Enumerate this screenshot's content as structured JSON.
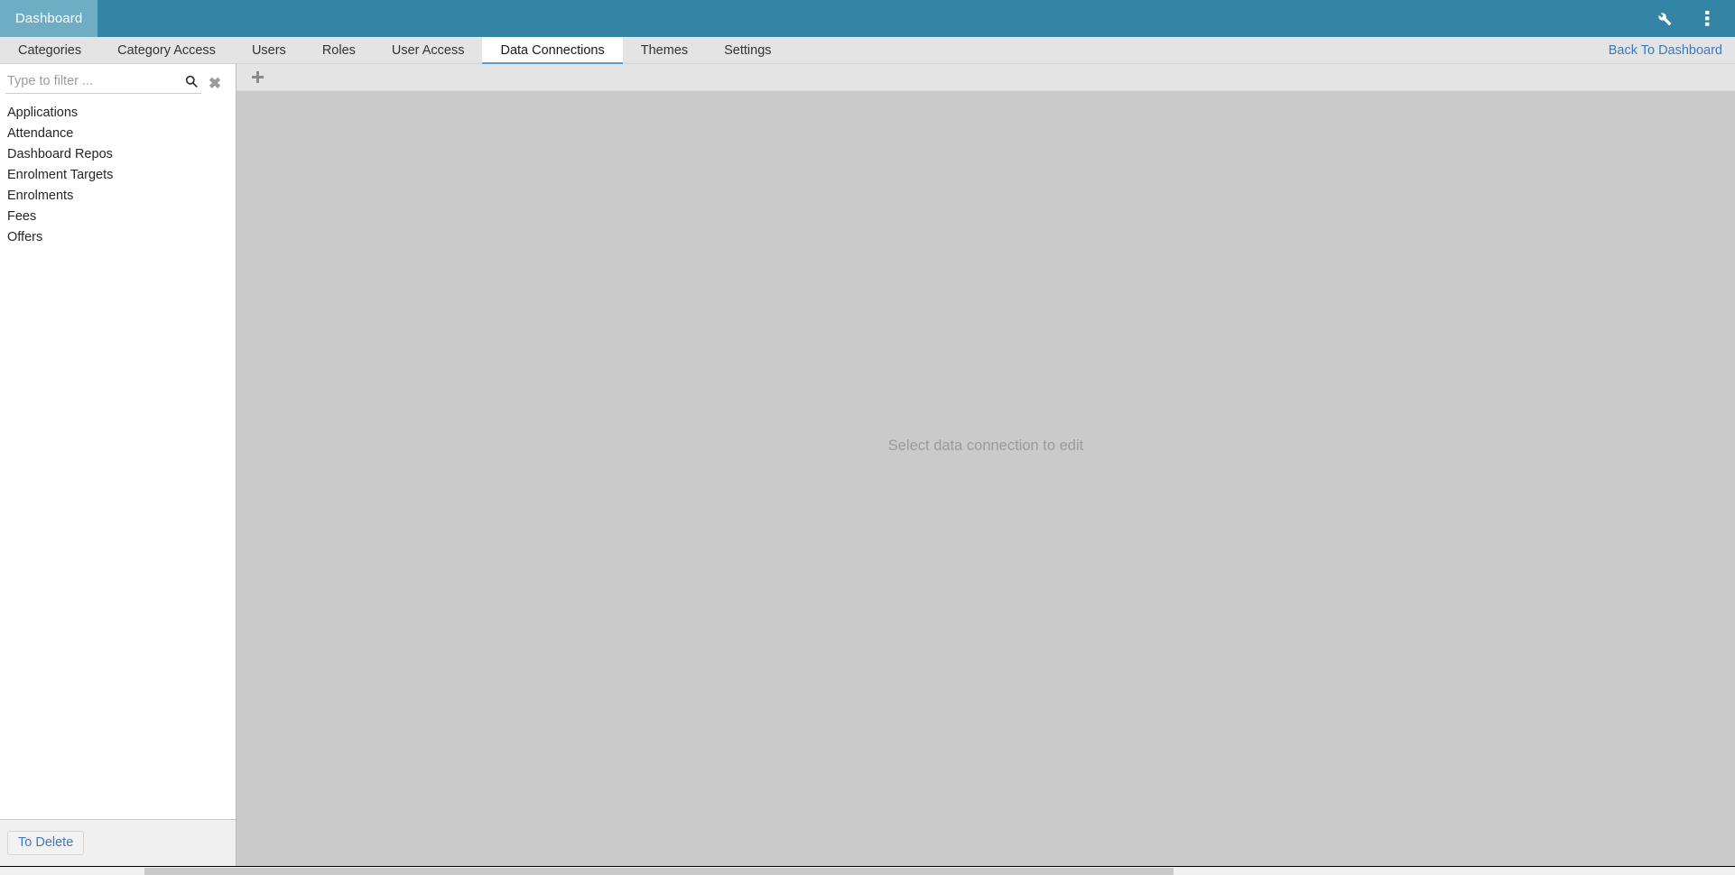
{
  "header": {
    "app_tab_label": "Dashboard",
    "icons": [
      {
        "name": "wrench-icon",
        "label": "Tools"
      },
      {
        "name": "more-vertical-icon",
        "label": "More options"
      }
    ],
    "bar_color": "#3484a5",
    "app_tab_color": "#6fadc4"
  },
  "tabs": {
    "items": [
      {
        "label": "Categories",
        "active": false
      },
      {
        "label": "Category Access",
        "active": false
      },
      {
        "label": "Users",
        "active": false
      },
      {
        "label": "Roles",
        "active": false
      },
      {
        "label": "User Access",
        "active": false
      },
      {
        "label": "Data Connections",
        "active": true
      },
      {
        "label": "Themes",
        "active": false
      },
      {
        "label": "Settings",
        "active": false
      }
    ],
    "active_index": 5,
    "active_underline_color": "#5b9bd5",
    "back_link": "Back To Dashboard",
    "link_color": "#3a7bbf"
  },
  "sidebar": {
    "filter": {
      "placeholder": "Type to filter ...",
      "value": "",
      "search_icon": "search-icon",
      "clear_icon": "clear-x-icon",
      "clear_glyph": "✖"
    },
    "connections": [
      {
        "label": "Applications"
      },
      {
        "label": "Attendance"
      },
      {
        "label": "Dashboard Repos"
      },
      {
        "label": "Enrolment Targets"
      },
      {
        "label": "Enrolments"
      },
      {
        "label": "Fees"
      },
      {
        "label": "Offers"
      }
    ],
    "footer": {
      "to_delete_label": "To Delete"
    }
  },
  "main": {
    "toolbar": {
      "add_icon": "plus-icon",
      "add_glyph": "＋"
    },
    "placeholder_message": "Select data connection to edit",
    "background_color": "#cacaca"
  }
}
